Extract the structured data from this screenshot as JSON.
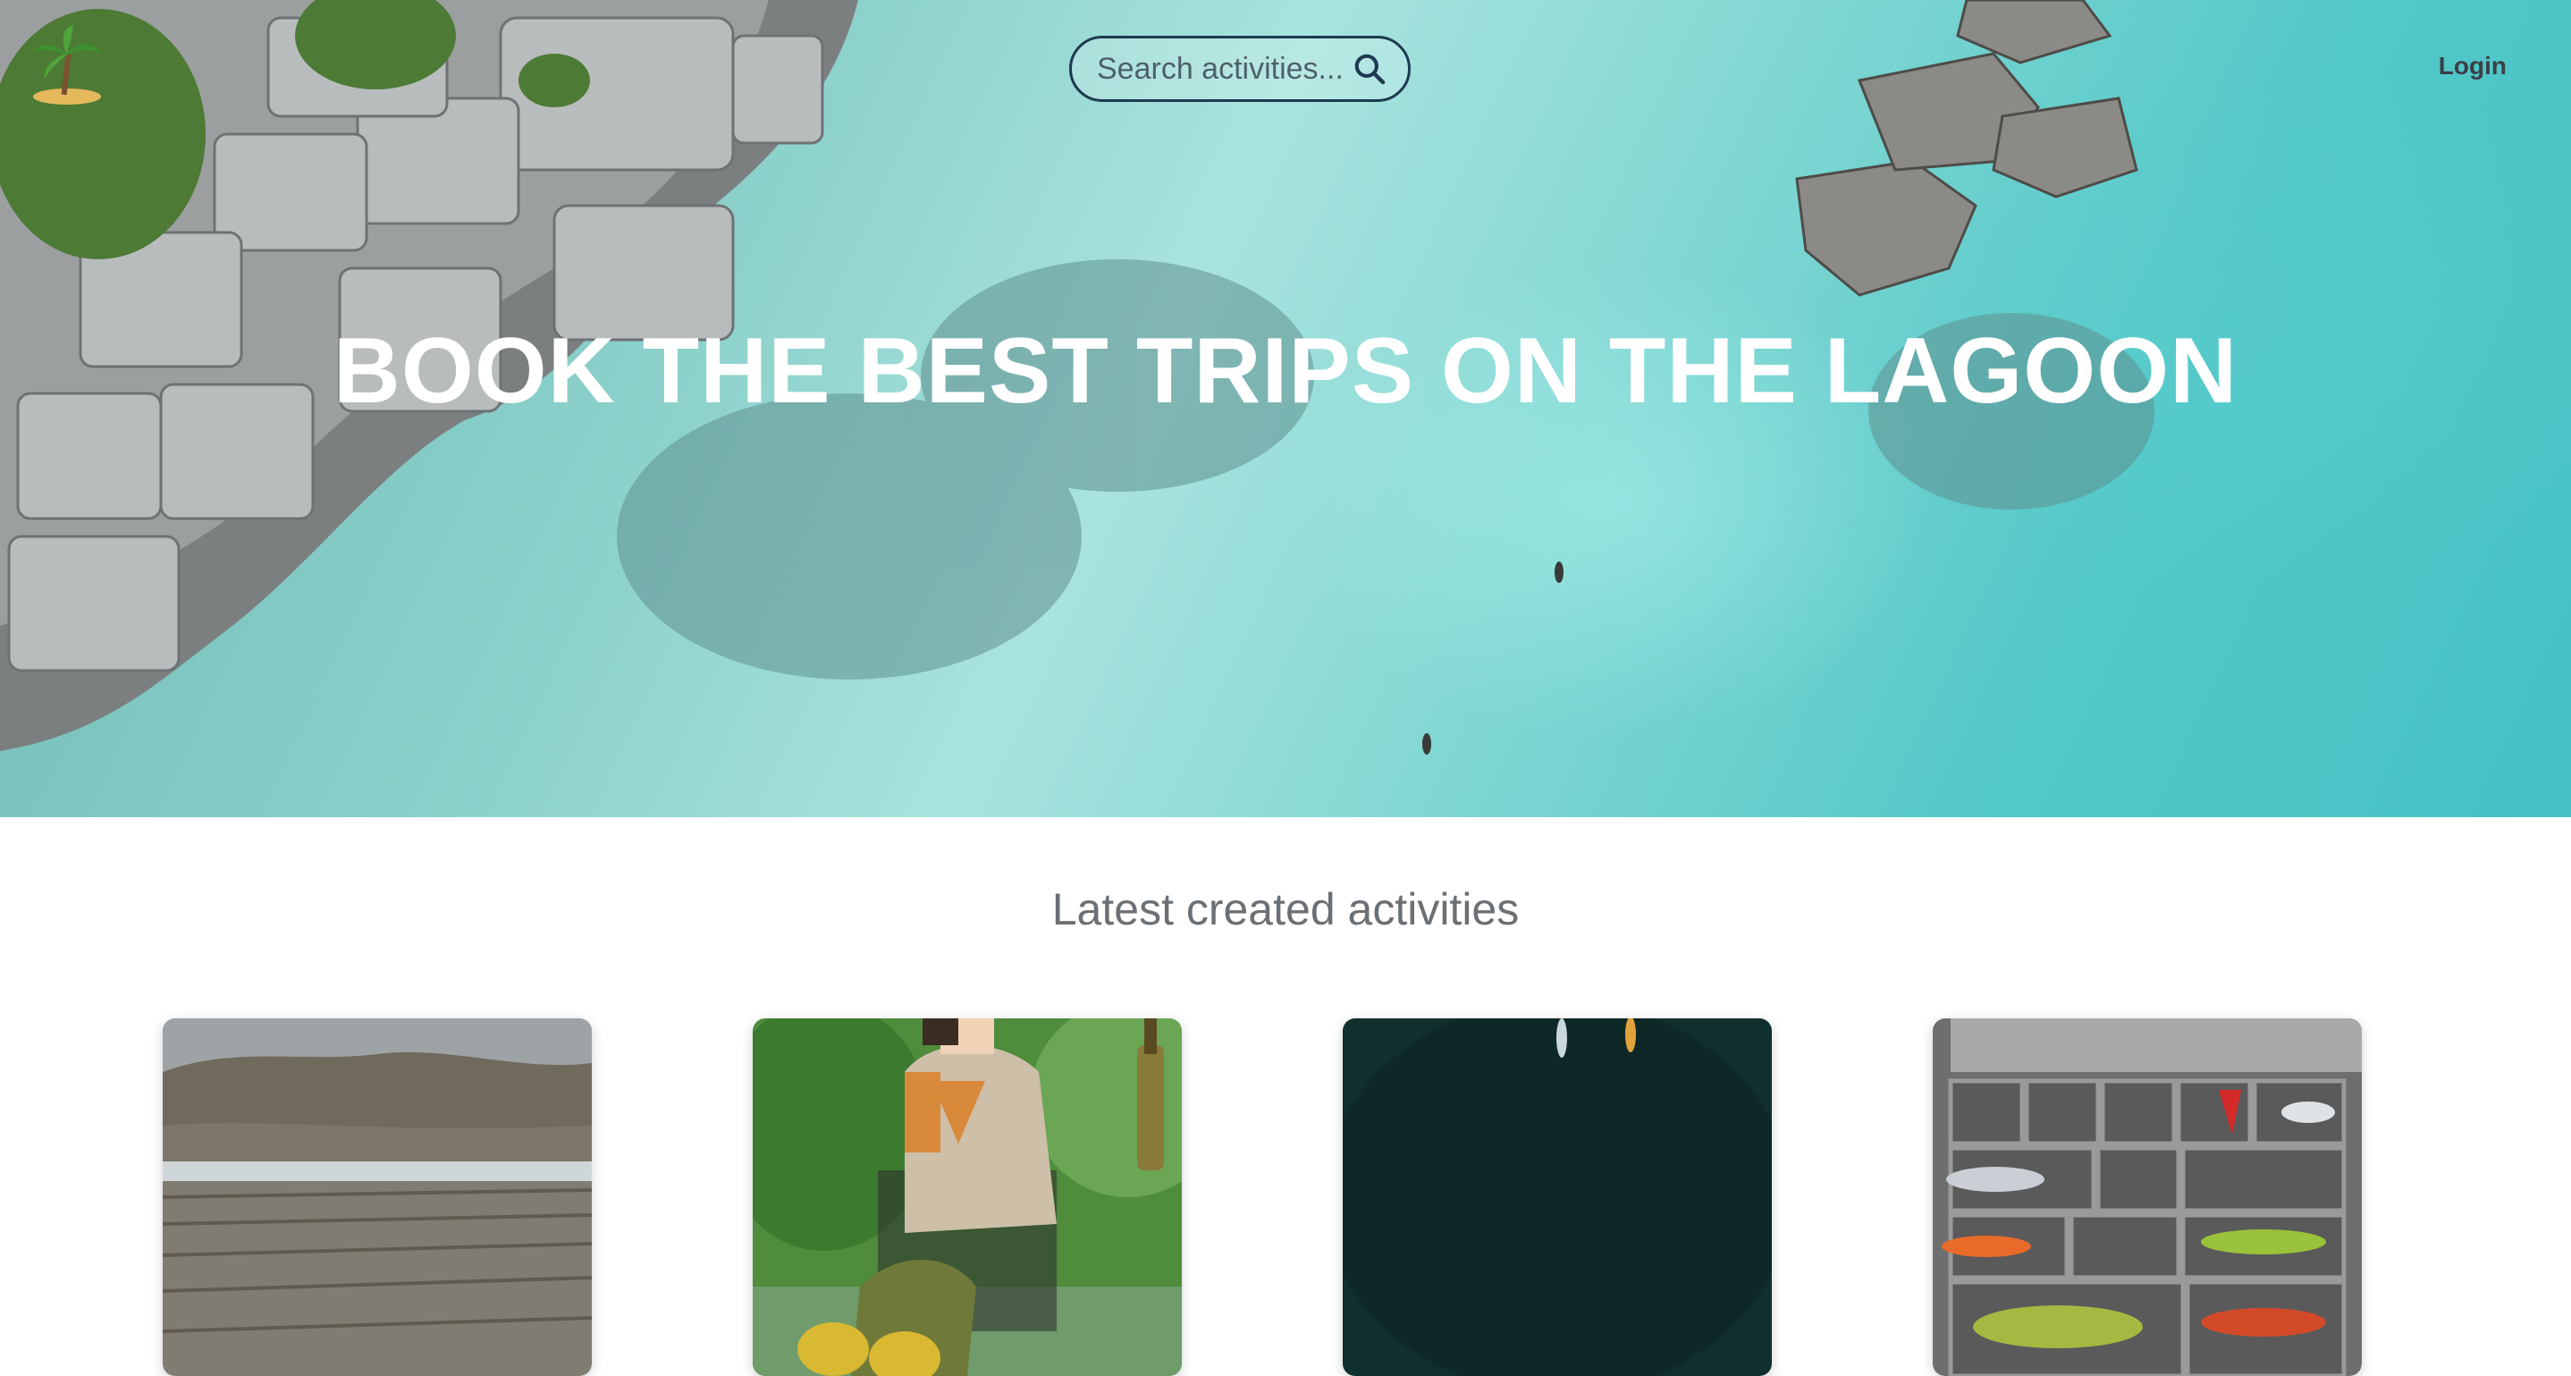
{
  "header": {
    "search": {
      "placeholder": "Search activities..."
    },
    "login_label": "Login"
  },
  "hero": {
    "headline": "BOOK THE BEST TRIPS ON THE LAGOON"
  },
  "activities": {
    "section_title": "Latest created activities"
  },
  "colors": {
    "lagoon": "#53c8c8",
    "search_border": "#1d3a52",
    "heading_text": "#6b7075"
  }
}
